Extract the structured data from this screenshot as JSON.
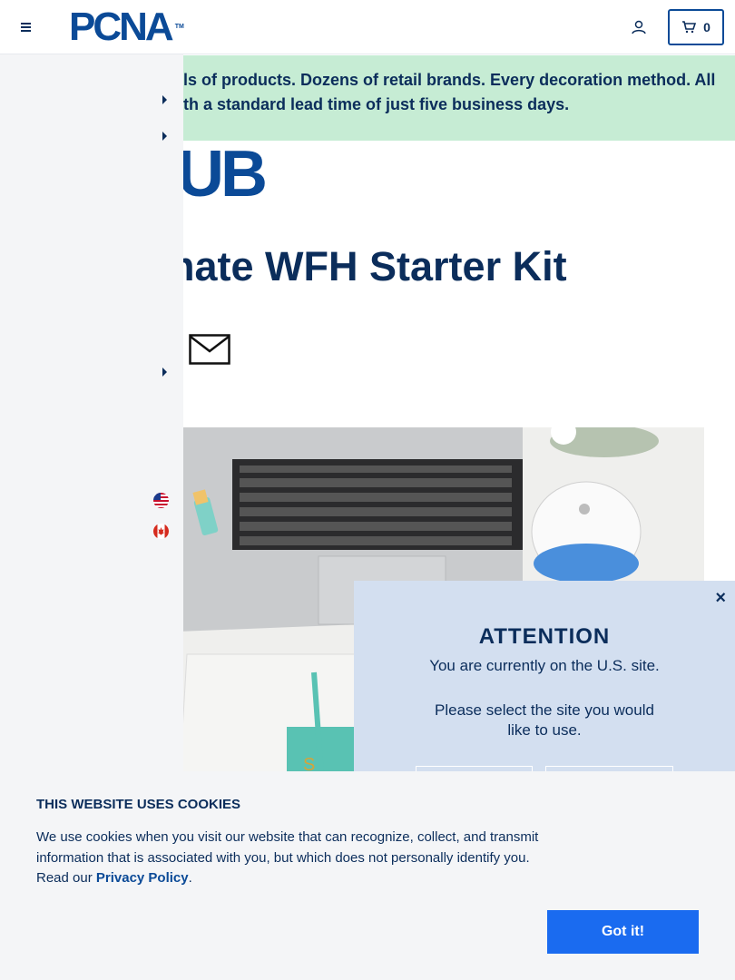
{
  "header": {
    "logo_text": "PCNA",
    "logo_tm": "TM",
    "cart_count": "0",
    "brand_color": "#0b4a97"
  },
  "banner": {
    "text": "ls of products. Dozens of retail brands. Every decoration method. All th a standard lead time of just five business days.",
    "background": "#c6ecd4"
  },
  "main": {
    "sub_logo_text": "UB",
    "title": "imate WFH Starter Kit"
  },
  "attention": {
    "heading": "ATTENTION",
    "message": "You are currently on the U.S. site.",
    "prompt": "Please select the site you would like to use.",
    "close_label": "×"
  },
  "cookie": {
    "heading": "THIS WEBSITE USES COOKIES",
    "text_before_link": "We use cookies when you visit our website that can recognize, collect, and transmit information that is associated with you, but which does not personally identify you. Read our ",
    "link_text": "Privacy Policy",
    "text_after_link": ".",
    "button_label": "Got it!",
    "button_color": "#1a6bf0"
  },
  "icons": {
    "menu": "hamburger-icon",
    "account": "user-icon",
    "cart": "cart-icon",
    "mail": "envelope-icon",
    "arrows": "caret-right-icon",
    "flag_us": "us-flag-icon",
    "flag_ca": "canada-flag-icon"
  }
}
